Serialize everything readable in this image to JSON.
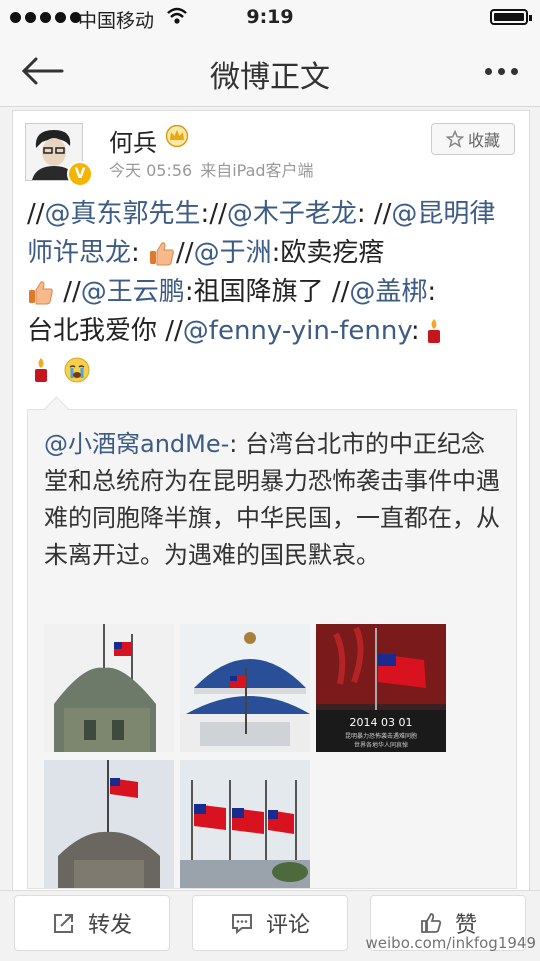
{
  "status_bar": {
    "carrier": "中国移动",
    "time": "9:19",
    "battery_level": 1.0
  },
  "nav": {
    "title": "微博正文",
    "back_icon": "arrow-left-icon",
    "more_icon": "more-dots-icon"
  },
  "post": {
    "username": "何兵",
    "verified_badge": "V",
    "time": "今天 05:56",
    "source": "来自iPad客户端",
    "favorite_label": "收藏",
    "text": {
      "s1": "//",
      "m1": "@真东郭先生",
      "s2": ":",
      "s3": "//",
      "m2": "@木子老龙",
      "s4": ": ",
      "s5": "//",
      "m3": "@昆明律师许思龙",
      "s6": ": ",
      "s7": "//",
      "m4": "@于洲",
      "s8": ":欧卖疙瘩",
      "s9": "//",
      "m5": "@王云鹏",
      "s10": ":祖国降旗了 ",
      "s11": "//",
      "m6": "@盖梆",
      "s12": ":",
      "s13": "台北我爱你 ",
      "s14": "//",
      "m7": "@fenny-yin-fenny",
      "s15": ":"
    }
  },
  "repost": {
    "mention": "@小酒窝andMe-",
    "text": ": 台湾台北市的中正纪念堂和总统府为在昆明暴力恐怖袭击事件中遇难的同胞降半旗，中华民国，一直都在，从未离开过。为遇难的国民默哀。",
    "images": [
      {
        "name": "presidential-office-flag"
      },
      {
        "name": "memorial-hall-flag"
      },
      {
        "name": "mourning-poster",
        "caption": "2014 03 01",
        "caption2": "昆明暴力恐怖袭击遇难同胞",
        "caption3": "世界各地华人同哀悼"
      },
      {
        "name": "tower-flag"
      },
      {
        "name": "three-flags"
      }
    ]
  },
  "bottom_bar": {
    "repost_label": "转发",
    "comment_label": "评论",
    "like_label": "赞"
  },
  "watermark": "weibo.com/inkfog1949",
  "colors": {
    "link": "#3c5b85",
    "flag_red": "#d8121f",
    "flag_blue": "#1a2b8f"
  }
}
